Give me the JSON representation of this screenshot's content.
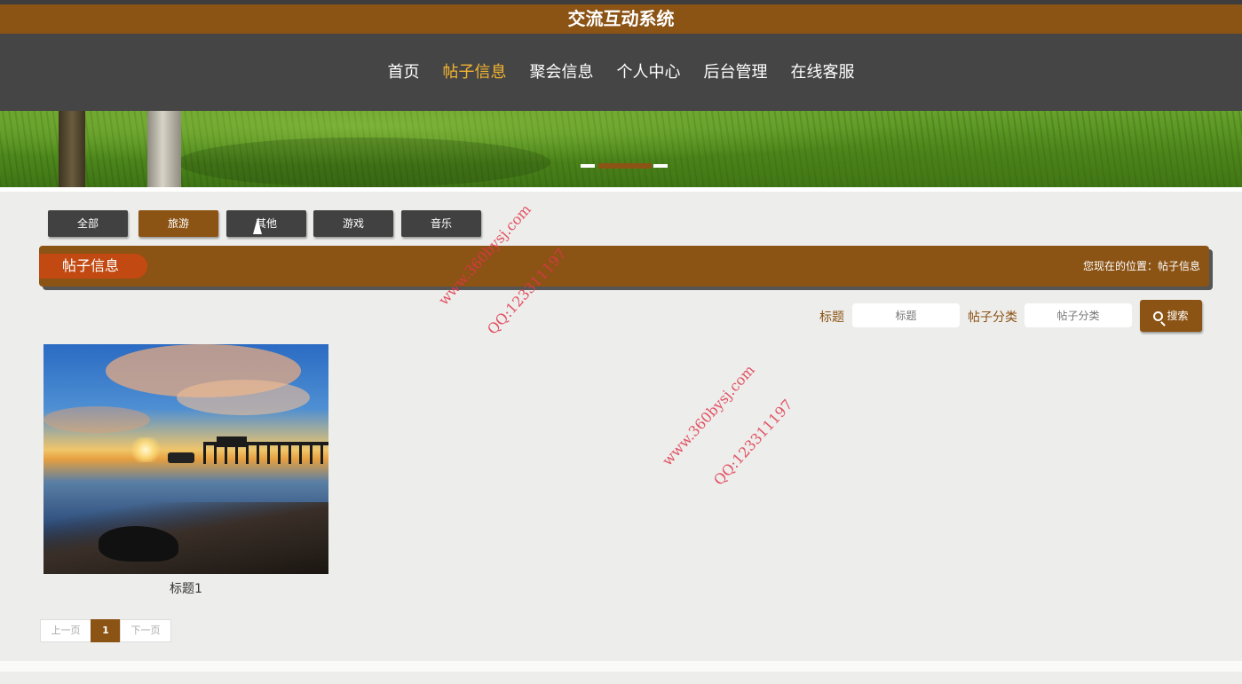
{
  "app": {
    "title": "交流互动系统"
  },
  "nav": {
    "items": [
      {
        "label": "首页"
      },
      {
        "label": "帖子信息"
      },
      {
        "label": "聚会信息"
      },
      {
        "label": "个人中心"
      },
      {
        "label": "后台管理"
      },
      {
        "label": "在线客服"
      }
    ],
    "active_index": 1
  },
  "banner": {
    "slides": 3,
    "active_slide": 1
  },
  "categories": [
    {
      "label": "全部"
    },
    {
      "label": "旅游"
    },
    {
      "label": "其他"
    },
    {
      "label": "游戏"
    },
    {
      "label": "音乐"
    }
  ],
  "section": {
    "title": "帖子信息",
    "location": "您现在的位置：帖子信息"
  },
  "search": {
    "title_label": "标题",
    "title_placeholder": "标题",
    "category_label": "帖子分类",
    "category_placeholder": "帖子分类",
    "button_label": "搜索"
  },
  "posts": [
    {
      "title": "标题1"
    }
  ],
  "pagination": {
    "prev": "上一页",
    "current": "1",
    "next": "下一页"
  },
  "watermarks": [
    {
      "text": "www.360bysj.com"
    },
    {
      "text": "QQ:123311197"
    },
    {
      "text": "www.360bysj.com"
    },
    {
      "text": "QQ:123311197"
    }
  ],
  "colors": {
    "brand": "#8b5314",
    "nav_bg": "#454545",
    "active_nav": "#f2b431",
    "section_tag": "#c24a12",
    "page_bg": "#ededeb",
    "watermark": "#e0364b"
  }
}
